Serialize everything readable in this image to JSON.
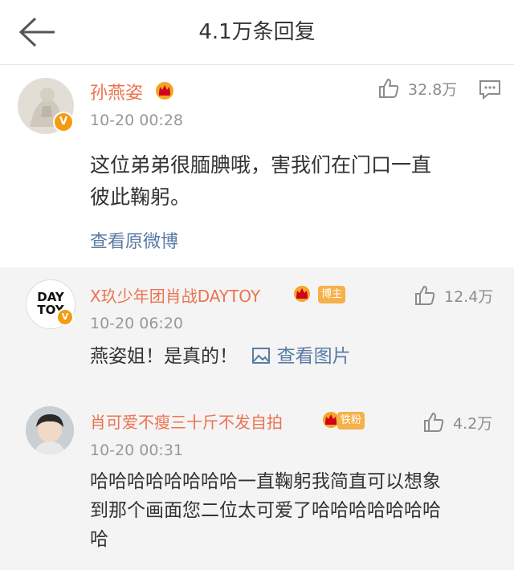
{
  "header": {
    "title": "4.1万条回复"
  },
  "root_comment": {
    "username": "孙燕姿",
    "verified": "V",
    "time": "10-20 00:28",
    "likes": "32.8万",
    "text_line1": "这位弟弟很腼腆哦，害我们在门口一直",
    "text_line2": "彼此鞠躬。",
    "view_original": "查看原微博"
  },
  "replies": [
    {
      "username": "X玖少年团肖战DAYTOY",
      "avatar_text_top": "DAY",
      "avatar_text_bottom": "TOY",
      "verified": "V",
      "badge": "博主",
      "time": "10-20 06:20",
      "likes": "12.4万",
      "text": "燕姿姐！是真的！",
      "image_link": "查看图片"
    },
    {
      "username": "肖可爱不瘦三十斤不发自拍",
      "badge": "铁粉",
      "time": "10-20 00:31",
      "likes": "4.2万",
      "text_line1": "哈哈哈哈哈哈哈哈一直鞠躬我简直可以想象",
      "text_line2": "到那个画面您二位太可爱了哈哈哈哈哈哈哈",
      "text_line3": "哈"
    }
  ],
  "colors": {
    "username": "#eb7350",
    "link": "#5a7aa5",
    "verified": "#f39c12",
    "badge": "#f6b14a"
  }
}
